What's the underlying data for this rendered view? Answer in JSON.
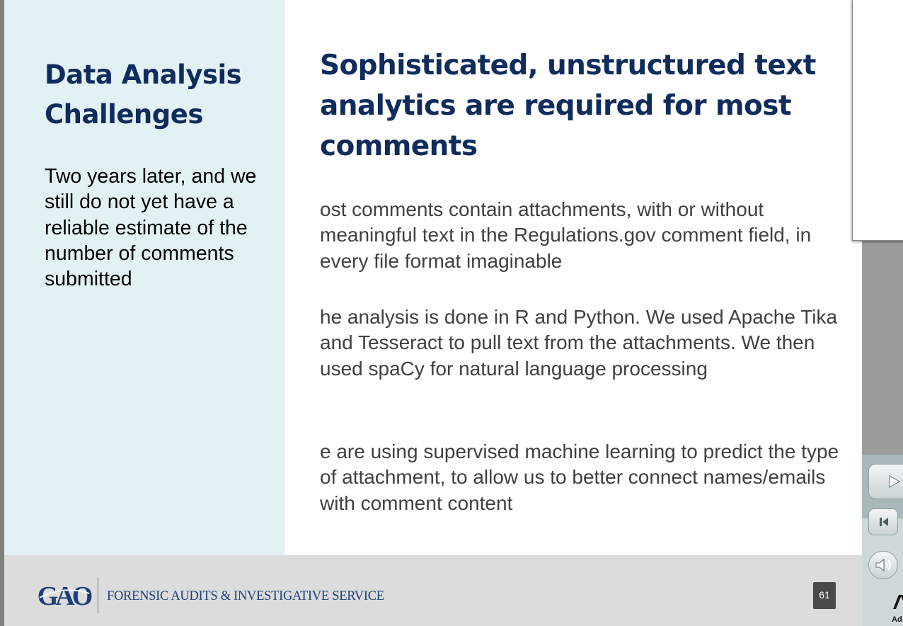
{
  "slide": {
    "side_title": "Data Analysis Challenges",
    "side_body": "Two years later, and we still do not yet have a reliable estimate of the number of comments submitted",
    "main_title": "Sophisticated, unstructured text analytics are required for most comments",
    "paragraphs": [
      "ost comments contain attachments, with or without meaningful text in the Regulations.gov comment field, in every file format imaginable",
      "he analysis is done in R and Python. We used Apache Tika and Tesseract to pull text from the attachments. We then used spaCy for natural language processing",
      "e are using supervised machine learning to predict the type of attachment, to allow us to better connect names/emails with comment content"
    ]
  },
  "footer": {
    "logo_text": "GAO",
    "org_text": "FORENSIC AUDITS & INVESTIGATIVE SERVICE",
    "page_number": "61"
  },
  "player": {
    "icons": [
      "play-icon",
      "skip-back-icon",
      "volume-icon",
      "adobe-logo-icon"
    ],
    "truncated_label": "Ad"
  },
  "colors": {
    "title_navy": "#0f2c5c",
    "side_panel": "#e2f2f4",
    "body_gray": "#404040",
    "footer_bg": "#dcdcdc",
    "footer_text": "#1c3e7a"
  }
}
